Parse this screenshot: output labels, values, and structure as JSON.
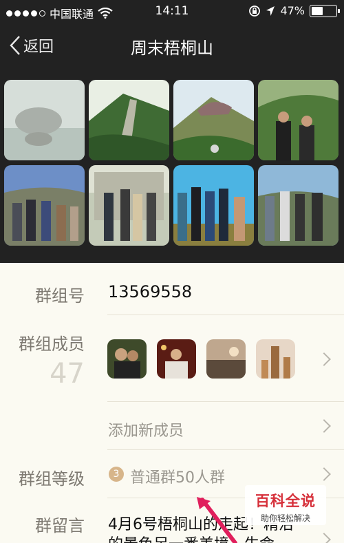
{
  "status_bar": {
    "carrier": "中国联通",
    "time": "14:11",
    "battery_percent": "47%",
    "battery_level": 0.47
  },
  "navbar": {
    "back_label": "返回",
    "title": "周末梧桐山"
  },
  "photos": [
    {
      "kind": "rock-in-fog"
    },
    {
      "kind": "mountain-trail"
    },
    {
      "kind": "summit-crowd"
    },
    {
      "kind": "two-hikers"
    },
    {
      "kind": "group-on-hill"
    },
    {
      "kind": "group-stone-gate"
    },
    {
      "kind": "group-blue-sky"
    },
    {
      "kind": "group-summit"
    }
  ],
  "group_info": {
    "id_label": "群组号",
    "id_value": "13569558",
    "members_label": "群组成员",
    "members_count": "47",
    "add_member_label": "添加新成员",
    "level_label": "群组等级",
    "level_badge": "3",
    "level_value": "普通群50人群",
    "message_label": "群留言",
    "message_line1": "4月6号梧桐山的走起！精治",
    "message_line2": "的景色足一番美境，生命"
  },
  "watermark": {
    "title": "百科全说",
    "subtitle": "助你轻松解决"
  },
  "colors": {
    "header_bg": "#222222",
    "page_bg": "#fbfaf2",
    "label": "#7e7a72",
    "badge": "#d7b58a",
    "watermark_red": "#d6303a"
  }
}
